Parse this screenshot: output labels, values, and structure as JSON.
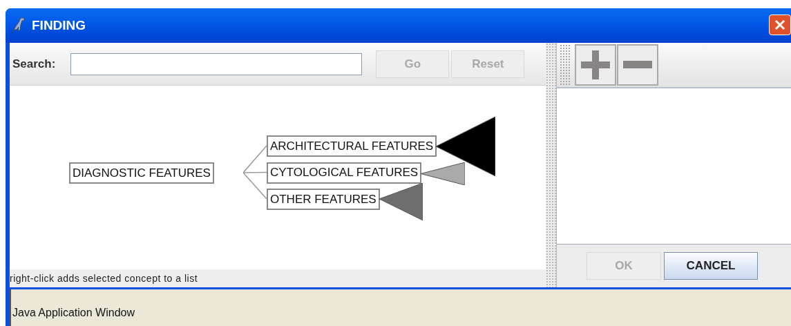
{
  "window": {
    "title": "FINDING"
  },
  "search": {
    "label": "Search:"
  },
  "search_buttons": [
    {
      "label": "Go",
      "disabled": true
    },
    {
      "label": "Reset",
      "disabled": true
    }
  ],
  "tree": {
    "label": "DIAGNOSTIC FEATURES",
    "children": [
      {
        "label": "ARCHITECTURAL FEATURES",
        "color": "#000000"
      },
      {
        "label": "CYTOLOGICAL FEATURES",
        "color": "#aaaaaa"
      },
      {
        "label": "OTHER FEATURES",
        "color": "#6e6e6e"
      }
    ]
  },
  "hint": "right-click adds selected concept to a list",
  "dialog_buttons": [
    {
      "label": "OK",
      "disabled": true
    },
    {
      "label": "CANCEL",
      "disabled": false
    }
  ],
  "status_bar": "Java Application Window"
}
